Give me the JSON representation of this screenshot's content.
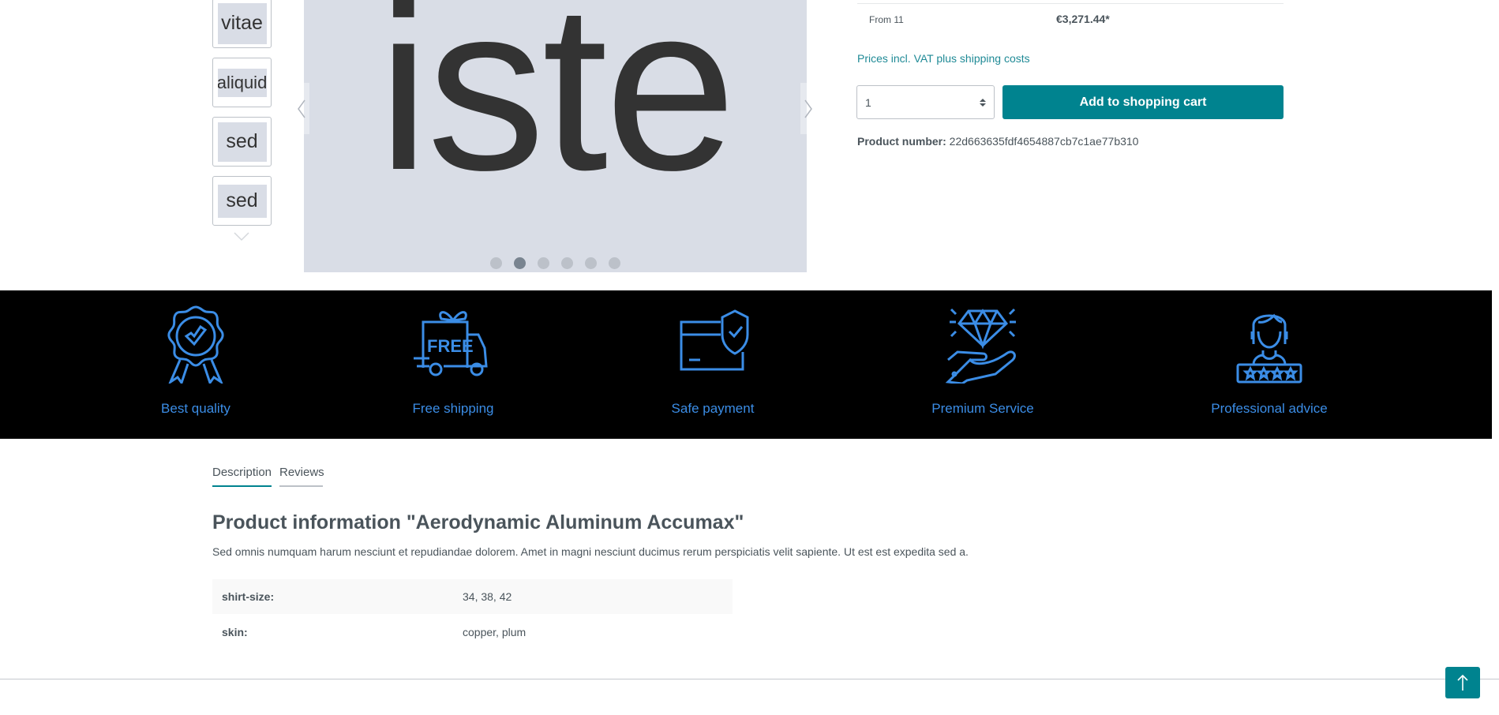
{
  "gallery": {
    "thumbnails": [
      "vitae",
      "aliquid",
      "sed",
      "sed"
    ],
    "main_image_text": "iste",
    "dots_count": 6,
    "active_dot": 2
  },
  "buy_box": {
    "price_row": {
      "label": "From 11",
      "price": "€3,271.44*"
    },
    "vat_notice": "Prices incl. VAT plus shipping costs",
    "quantity": "1",
    "add_to_cart_label": "Add to shopping cart",
    "product_number_label": "Product number:",
    "product_number": "22d663635fdf4654887cb7c1ae77b310"
  },
  "features": [
    {
      "icon": "award-badge-icon",
      "label": "Best quality"
    },
    {
      "icon": "free-delivery-truck-icon",
      "label": "Free shipping",
      "icon_text": "FREE"
    },
    {
      "icon": "secure-card-shield-icon",
      "label": "Safe payment"
    },
    {
      "icon": "diamond-hand-icon",
      "label": "Premium Service"
    },
    {
      "icon": "support-agent-rating-icon",
      "label": "Professional advice"
    }
  ],
  "colors": {
    "accent": "#00838f",
    "feature_blue": "#3b8de6",
    "feature_bar_bg": "#000000"
  },
  "tabs": [
    {
      "label": "Description",
      "active": true
    },
    {
      "label": "Reviews",
      "active": false
    }
  ],
  "description": {
    "title": "Product information \"Aerodynamic Aluminum Accumax\"",
    "text": "Sed omnis numquam harum nesciunt et repudiandae dolorem. Amet in magni nesciunt ducimus rerum perspiciatis velit sapiente. Ut est est expedita sed a.",
    "properties": [
      {
        "name": "shirt-size:",
        "value": "34, 38, 42"
      },
      {
        "name": "skin:",
        "value": "copper, plum"
      }
    ]
  },
  "scroll_top_icon": "arrow-up-icon"
}
